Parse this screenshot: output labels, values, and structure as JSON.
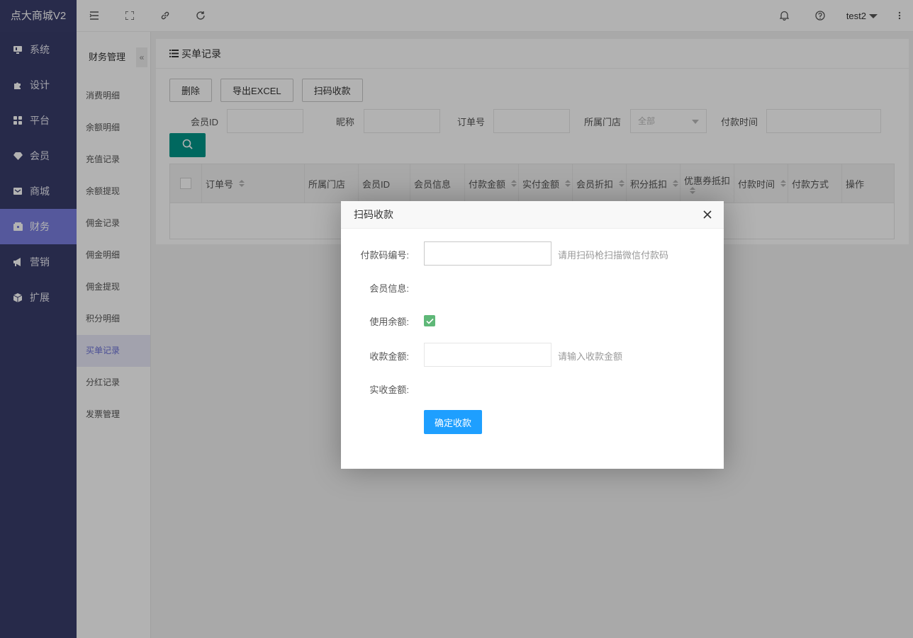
{
  "brand": "点大商城V2",
  "sidebar": {
    "items": [
      {
        "label": "系统",
        "icon": "monitor-icon"
      },
      {
        "label": "设计",
        "icon": "puzzle-icon"
      },
      {
        "label": "平台",
        "icon": "grid-icon"
      },
      {
        "label": "会员",
        "icon": "diamond-icon"
      },
      {
        "label": "商城",
        "icon": "mail-icon"
      },
      {
        "label": "财务",
        "icon": "wallet-icon"
      },
      {
        "label": "营销",
        "icon": "megaphone-icon"
      },
      {
        "label": "扩展",
        "icon": "cube-icon"
      }
    ],
    "active": "财务"
  },
  "topbar": {
    "user": "test2"
  },
  "subnav": {
    "title": "财务管理",
    "collapse": "«",
    "items": [
      "消费明细",
      "余额明细",
      "充值记录",
      "余额提现",
      "佣金记录",
      "佣金明细",
      "佣金提现",
      "积分明细",
      "买单记录",
      "分红记录",
      "发票管理"
    ],
    "active": "买单记录"
  },
  "page": {
    "title": "买单记录",
    "buttons": {
      "delete": "删除",
      "export": "导出EXCEL",
      "scan": "扫码收款"
    },
    "filters": {
      "member_id": "会员ID",
      "nickname": "昵称",
      "order_no": "订单号",
      "store": "所属门店",
      "store_value": "全部",
      "pay_time": "付款时间"
    },
    "table": {
      "columns": [
        "订单号",
        "所属门店",
        "会员ID",
        "会员信息",
        "付款金额",
        "实付金额",
        "会员折扣",
        "积分抵扣",
        "优惠券抵扣",
        "付款时间",
        "付款方式",
        "操作"
      ]
    }
  },
  "modal": {
    "title": "扫码收款",
    "pay_code_label": "付款码编号:",
    "pay_code_hint": "请用扫码枪扫描微信付款码",
    "member_info_label": "会员信息:",
    "use_balance_label": "使用余额:",
    "use_balance_checked": true,
    "amount_label": "收款金额:",
    "amount_hint": "请输入收款金额",
    "actual_label": "实收金额:",
    "submit": "确定收款"
  },
  "colors": {
    "sidebar_bg": "#393D6B",
    "sidebar_active": "#7a7fe0",
    "search_btn": "#009688",
    "submit_btn": "#1E9FFF",
    "checkbox": "#5FB878"
  }
}
